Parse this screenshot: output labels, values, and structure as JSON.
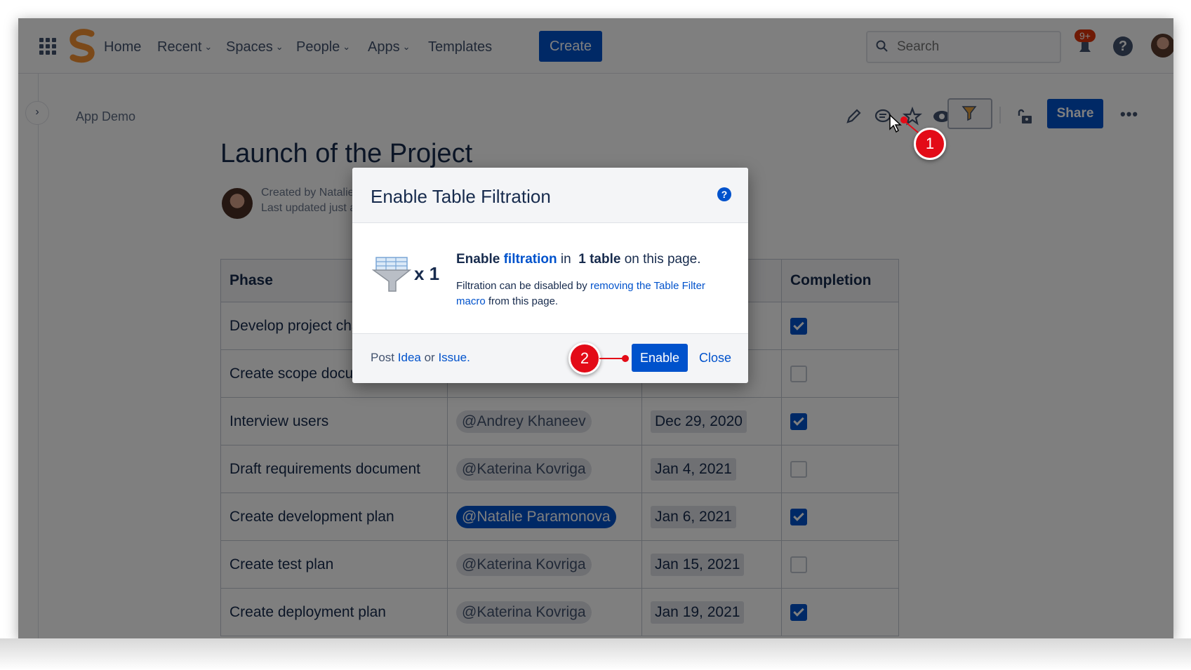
{
  "nav": {
    "home": "Home",
    "recent": "Recent",
    "spaces": "Spaces",
    "people": "People",
    "apps": "Apps",
    "templates": "Templates",
    "create": "Create",
    "search_placeholder": "Search",
    "notifications_badge": "9+",
    "help": "?"
  },
  "page": {
    "breadcrumb": "App Demo",
    "title": "Launch of the Project",
    "created_by": "Created by Natalie",
    "last_updated": "Last updated just a",
    "share": "Share",
    "more": "•••"
  },
  "table": {
    "headers": [
      "Phase",
      "",
      "",
      "Completion"
    ],
    "rows": [
      {
        "phase": "Develop project cha",
        "owner": "",
        "date": "",
        "done": true,
        "self": false
      },
      {
        "phase": "Create scope docum",
        "owner": "",
        "date": "",
        "done": false,
        "self": false
      },
      {
        "phase": "Interview users",
        "owner": "@Andrey Khaneev",
        "date": "Dec 29, 2020",
        "done": true,
        "self": false
      },
      {
        "phase": "Draft requirements document",
        "owner": "@Katerina Kovriga",
        "date": "Jan 4, 2021",
        "done": false,
        "self": false
      },
      {
        "phase": "Create development plan",
        "owner": "@Natalie Paramonova",
        "date": "Jan 6, 2021",
        "done": true,
        "self": true
      },
      {
        "phase": "Create test plan",
        "owner": "@Katerina Kovriga",
        "date": "Jan 15, 2021",
        "done": false,
        "self": false
      },
      {
        "phase": "Create deployment plan",
        "owner": "@Katerina Kovriga",
        "date": "Jan 19, 2021",
        "done": true,
        "self": false
      }
    ]
  },
  "dialog": {
    "title": "Enable Table Filtration",
    "help": "?",
    "count": "x 1",
    "line_enable": "Enable",
    "line_filtration": "filtration",
    "line_in": "in",
    "line_table": "1 table",
    "line_rest": "on this page.",
    "sub_1": "Filtration can be disabled by",
    "sub_link": "removing the Table Filter macro",
    "sub_2": "from this page.",
    "post": "Post",
    "idea": "Idea",
    "or": "or",
    "issue": "Issue",
    "period": ".",
    "enable_button": "Enable",
    "close_button": "Close"
  },
  "callouts": {
    "one": "1",
    "two": "2"
  },
  "colors": {
    "brand_blue": "#0052cc",
    "callout_red": "#e30b17",
    "logo_orange": "#f79232"
  }
}
